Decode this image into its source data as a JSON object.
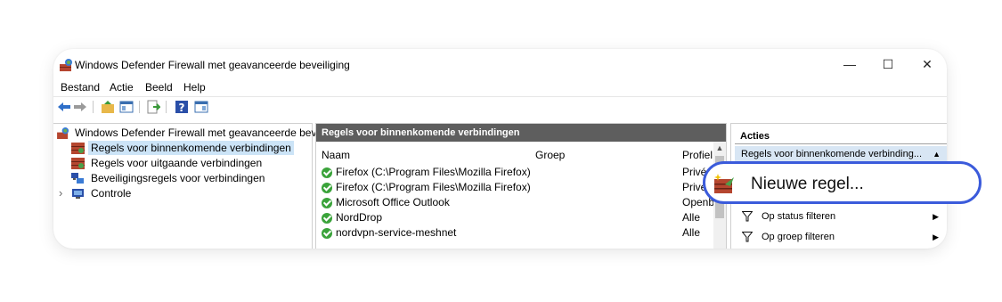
{
  "window": {
    "title": "Windows Defender Firewall met geavanceerde beveiliging",
    "controls": {
      "minimize": "—",
      "maximize": "☐",
      "close": "✕"
    }
  },
  "menu": [
    "Bestand",
    "Actie",
    "Beeld",
    "Help"
  ],
  "toolbar": [
    "back-arrow-icon",
    "forward-arrow-icon",
    "up-folder-icon",
    "show-hide-tree-icon",
    "export-list-icon",
    "help-icon",
    "show-hide-action-pane-icon"
  ],
  "tree": {
    "root": "Windows Defender Firewall met geavanceerde beveili",
    "items": [
      "Regels voor binnenkomende verbindingen",
      "Regels voor uitgaande verbindingen",
      "Beveiligingsregels voor verbindingen",
      "Controle"
    ],
    "expand_glyph": "›"
  },
  "rules": {
    "header": "Regels voor binnenkomende verbindingen",
    "columns": {
      "name": "Naam",
      "group": "Groep",
      "profile": "Profiel"
    },
    "rows": [
      {
        "name": "Firefox (C:\\Program Files\\Mozilla Firefox)",
        "profile": "Privé"
      },
      {
        "name": "Firefox (C:\\Program Files\\Mozilla Firefox)",
        "profile": "Privé"
      },
      {
        "name": "Microsoft Office Outlook",
        "profile": "Openb"
      },
      {
        "name": "NordDrop",
        "profile": "Alle"
      },
      {
        "name": "nordvpn-service-meshnet",
        "profile": "Alle"
      }
    ]
  },
  "actions": {
    "header": "Acties",
    "subheader": "Regels voor binnenkomende verbinding...",
    "items": [
      "Op status filteren",
      "Op groep filteren"
    ]
  },
  "callout": {
    "label": "Nieuwe regel..."
  },
  "colors": {
    "accent": "#3b5bdb",
    "selection": "#cce4f7",
    "header": "#5e5e5e",
    "check": "#3aa33a"
  }
}
